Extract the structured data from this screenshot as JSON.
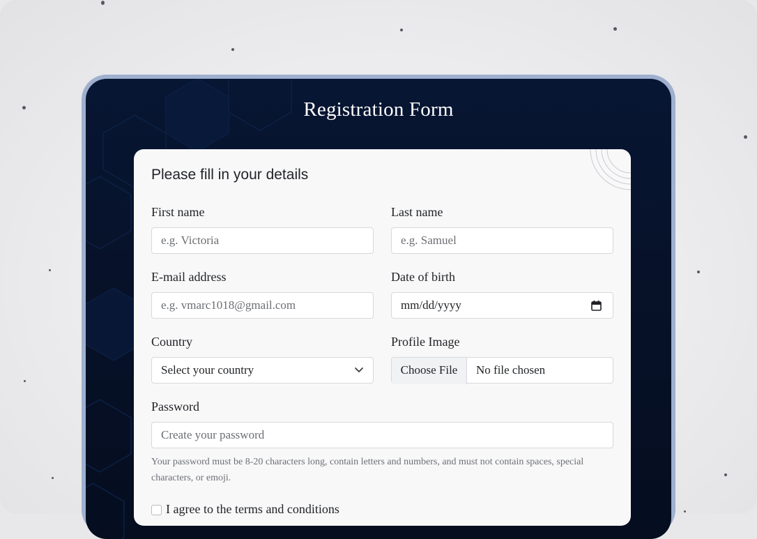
{
  "form": {
    "title": "Registration Form",
    "heading": "Please fill in your details"
  },
  "fields": {
    "first_name": {
      "label": "First name",
      "placeholder": "e.g. Victoria"
    },
    "last_name": {
      "label": "Last name",
      "placeholder": "e.g. Samuel"
    },
    "email": {
      "label": "E-mail address",
      "placeholder": "e.g. vmarc1018@gmail.com"
    },
    "dob": {
      "label": "Date of birth",
      "value": "mm/dd/yyyy"
    },
    "country": {
      "label": "Country",
      "selected": "Select your country"
    },
    "profile_image": {
      "label": "Profile Image",
      "button": "Choose File",
      "status": "No file chosen"
    },
    "password": {
      "label": "Password",
      "placeholder": "Create your password",
      "hint": "Your password must be 8-20 characters long, contain letters and numbers, and must not contain spaces, special characters, or emoji."
    }
  },
  "terms": {
    "label": "I agree to the terms and conditions"
  },
  "icons": {
    "select_arrow": "chevron-down-icon",
    "date_picker": "calendar-icon"
  },
  "colors": {
    "screen_bg": "#071633",
    "frame": "#9fb0cf",
    "card_bg": "#f8f8f9"
  }
}
